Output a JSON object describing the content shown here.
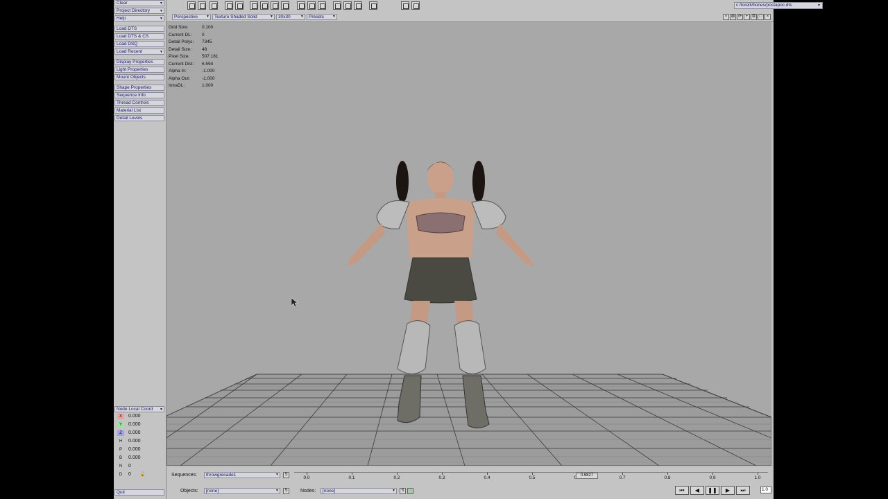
{
  "left_menu": {
    "groups": [
      [
        "Clear",
        "Project Directory",
        "Help"
      ],
      [
        "Load DTS",
        "Load DTS & CS",
        "Load DSQ",
        "Load Recent"
      ],
      [
        "Display Properties",
        "Light Properties",
        "Mount Objects"
      ],
      [
        "Shape Properties",
        "Sequence Info",
        "Thread Controls",
        "Material List",
        "Detail Levels"
      ]
    ]
  },
  "coords": {
    "header": "Node Local Coord",
    "rows": [
      {
        "key": "X",
        "value": "0.000",
        "color": "#e8a0a0"
      },
      {
        "key": "Y",
        "value": "0.000",
        "color": "#a0e0a0"
      },
      {
        "key": "Z",
        "value": "0.000",
        "color": "#a0a0e8"
      },
      {
        "key": "H",
        "value": "0.000",
        "color": ""
      },
      {
        "key": "P",
        "value": "0.000",
        "color": ""
      },
      {
        "key": "B",
        "value": "0.000",
        "color": ""
      },
      {
        "key": "N",
        "value": "0",
        "color": ""
      },
      {
        "key": "D",
        "value": "0",
        "color": ""
      }
    ],
    "quit_label": "Quit"
  },
  "toolbar": {
    "file_path": "c:/torelli/bones/postapoc.dts"
  },
  "viewbar": {
    "view_mode": "Perspective",
    "shading": "Texture Shaded Solid",
    "grid": "30x30",
    "presets": "Presets"
  },
  "stats": [
    {
      "label": "Grid Size:",
      "value": "0.100"
    },
    {
      "label": "Current DL:",
      "value": "0"
    },
    {
      "label": "Detail Polys:",
      "value": "7345"
    },
    {
      "label": "Detail Size:",
      "value": "48"
    },
    {
      "label": "Pixel Size:",
      "value": "507.181"
    },
    {
      "label": "Current Dist:",
      "value": "6.594"
    },
    {
      "label": "Alpha In:",
      "value": "-1.000"
    },
    {
      "label": "Alpha Out:",
      "value": "-1.000"
    },
    {
      "label": "IntraDL:",
      "value": "1.000"
    }
  ],
  "bottom": {
    "sequences_label": "Sequences:",
    "sequence_value": "throwgrenade1",
    "objects_label": "Objects:",
    "objects_value": "[none]",
    "nodes_label": "Nodes:",
    "nodes_value": "[none]",
    "s_label": "S",
    "timeline_ticks": [
      "0.0",
      "0.1",
      "0.2",
      "0.3",
      "0.4",
      "0.5",
      "0.6",
      "0.7",
      "0.8",
      "0.9",
      "1.0"
    ],
    "time_marker": "0.6827",
    "speed": "1.0"
  },
  "colors": {
    "background": "#a8a8a8",
    "panel": "#c4c4c4",
    "button": "#d6d6de"
  }
}
